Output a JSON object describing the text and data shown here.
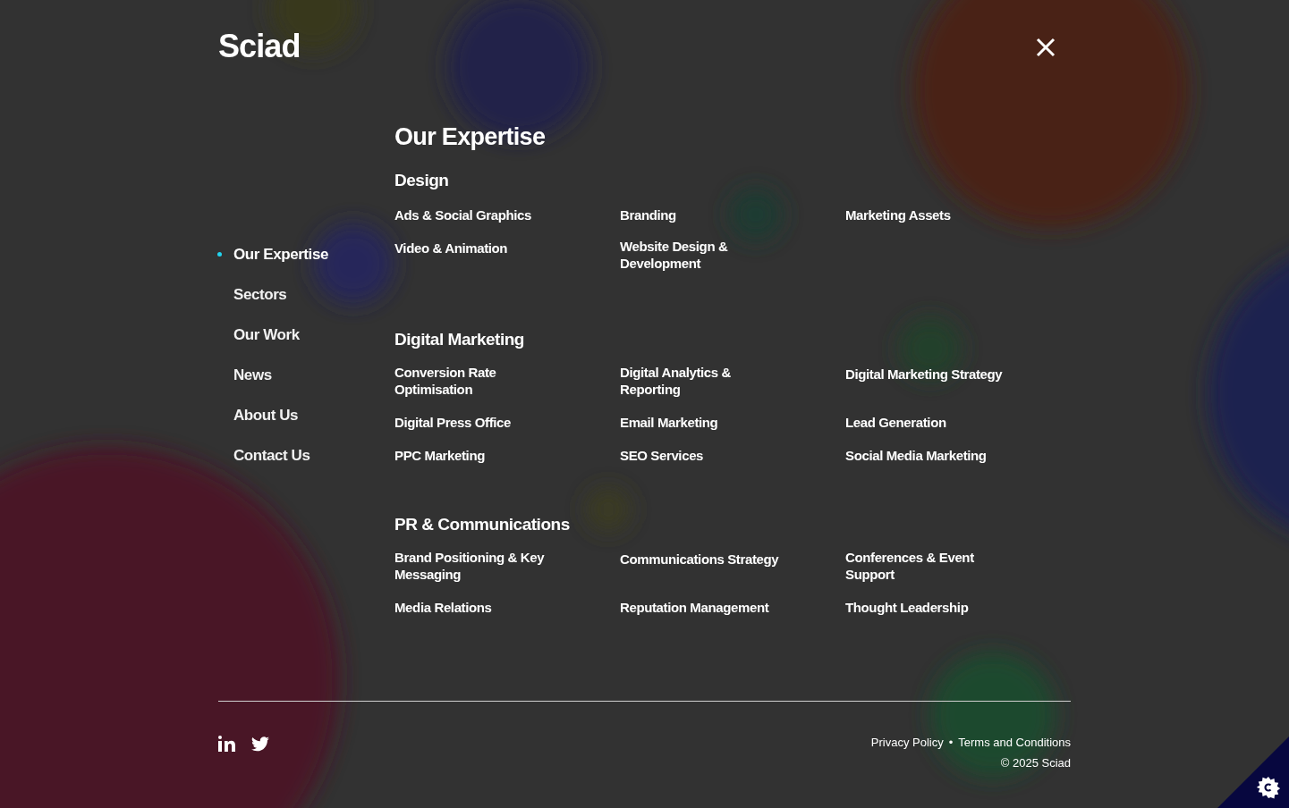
{
  "logo": "Sciad",
  "nav": [
    {
      "label": "Our Expertise",
      "selected": true
    },
    {
      "label": "Sectors",
      "selected": false
    },
    {
      "label": "Our Work",
      "selected": false
    },
    {
      "label": "News",
      "selected": false
    },
    {
      "label": "About Us",
      "selected": false
    },
    {
      "label": "Contact Us",
      "selected": false
    }
  ],
  "title": "Our Expertise",
  "sections": [
    {
      "heading": "Design",
      "items": [
        "Ads & Social Graphics",
        "Branding",
        "Marketing Assets",
        "Video & Animation",
        "Website Design & Development"
      ]
    },
    {
      "heading": "Digital Marketing",
      "items": [
        "Conversion Rate Optimisation",
        "Digital Analytics & Reporting",
        "Digital Marketing Strategy",
        "Digital Press Office",
        "Email Marketing",
        "Lead Generation",
        "PPC Marketing",
        "SEO Services",
        "Social Media Marketing"
      ]
    },
    {
      "heading": "PR & Communications",
      "items": [
        "Brand Positioning & Key Messaging",
        "Communications Strategy",
        "Conferences & Event Support",
        "Media Relations",
        "Reputation Management",
        "Thought Leadership"
      ]
    }
  ],
  "footer": {
    "links": [
      "Privacy Policy",
      "Terms and Conditions"
    ],
    "separator": "•",
    "copyright": "© 2025 Sciad"
  }
}
